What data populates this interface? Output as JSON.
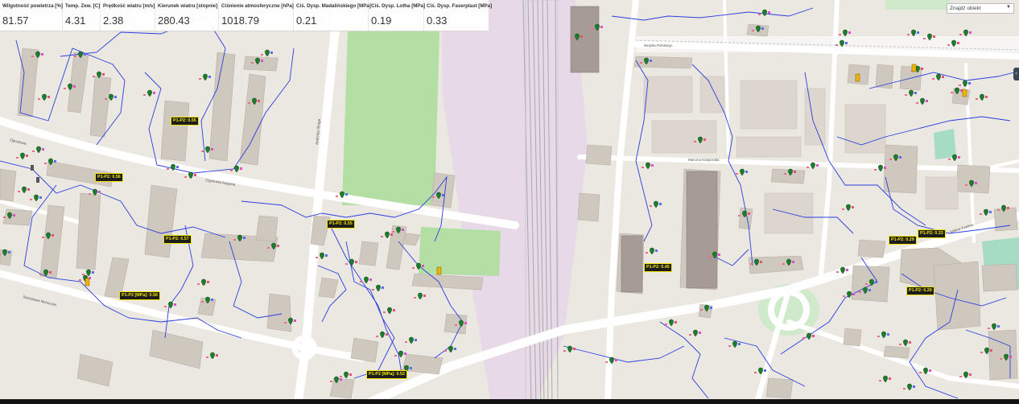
{
  "weather": {
    "columns": [
      {
        "label": "Wilgotność powietrza [%]",
        "value": "81.57"
      },
      {
        "label": "Temp. Zew. [C]",
        "value": "4.31"
      },
      {
        "label": "Prędkość wiatru [m/s]",
        "value": "2.38"
      },
      {
        "label": "Kierunek wiatru [stopnie]",
        "value": "280.43"
      },
      {
        "label": "Ciśnienie atmosferyczne [hPa]",
        "value": "1018.79"
      },
      {
        "label": "Ciś. Dysp. Madalińskiego [MPa]",
        "value": "0.21"
      },
      {
        "label": "Ciś. Dysp. Lotha [MPa]",
        "value": "0.19"
      },
      {
        "label": "Ciś. Dysp. Faserplast [MPa]",
        "value": "0.33"
      }
    ]
  },
  "search": {
    "placeholder": "Znajdź obiekt"
  },
  "pressure_labels": [
    "P1-P2: 0.55",
    "P1-P2: 0.56",
    "P1-P2: 0.55",
    "P1-P2: 0.57",
    "P1-P2 [MPa]: 0.56",
    "P1-P2 [MPa]: 0.52",
    "P1-P2: 0.45",
    "P1-P2: 0.29",
    "P1-P2: 0.33",
    "P1-P2: 0.29"
  ],
  "street_names": [
    "Ogrodowa",
    "Zygmunta Augusta",
    "Marcina Kasprzaka",
    "Wojska Polskiego",
    "Juliana Tuwima",
    "Stanisława Moniuszki",
    "Andrzeja Struga"
  ],
  "colors": {
    "network_line": "#2a3de0",
    "marker": "#1e7d2c",
    "label_bg": "#1d1d1d",
    "label_text": "#f2e600",
    "building": "#cfc8bf",
    "building_block": "#a79c95",
    "field_green": "#a9dc9a",
    "rail_area": "#e6d8e8",
    "road": "#ffffff"
  }
}
